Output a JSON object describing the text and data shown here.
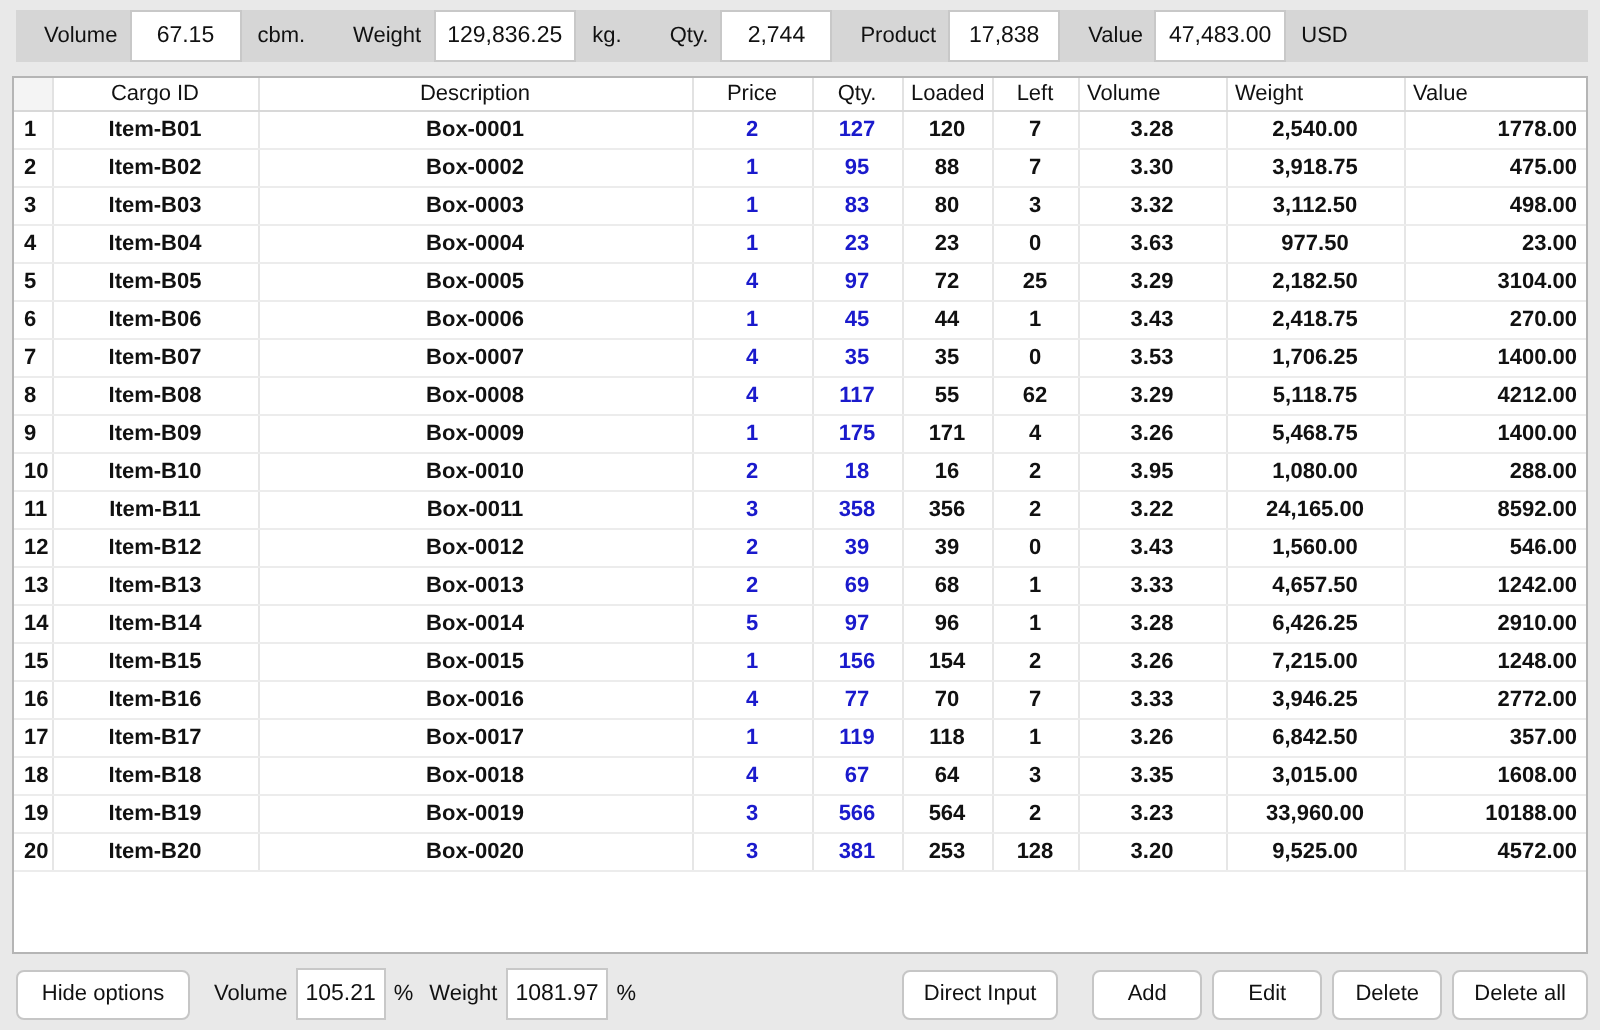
{
  "summary": [
    {
      "label": "Volume",
      "value": "67.15",
      "unit": "cbm."
    },
    {
      "label": "Weight",
      "value": "129,836.25",
      "unit": "kg."
    },
    {
      "label": "Qty.",
      "value": "2,744"
    },
    {
      "label": "Product",
      "value": "17,838"
    },
    {
      "label": "Value",
      "value": "47,483.00",
      "unit": "USD"
    }
  ],
  "table": {
    "columns": [
      {
        "kind": "index"
      },
      {
        "label": "Cargo ID",
        "kind": "plain"
      },
      {
        "label": "Description",
        "kind": "plain"
      },
      {
        "label": "Price",
        "kind": "input"
      },
      {
        "label": "Qty.",
        "kind": "input"
      },
      {
        "label": "Loaded",
        "kind": "plain"
      },
      {
        "label": "Left",
        "kind": "plain"
      },
      {
        "label": "Volume",
        "kind": "plain"
      },
      {
        "label": "Weight",
        "kind": "plain"
      },
      {
        "label": "Value",
        "kind": "plain"
      }
    ],
    "rows": [
      [
        "1",
        "Item-B01",
        "Box-0001",
        "2",
        "127",
        "120",
        "7",
        "3.28",
        "2,540.00",
        "1778.00"
      ],
      [
        "2",
        "Item-B02",
        "Box-0002",
        "1",
        "95",
        "88",
        "7",
        "3.30",
        "3,918.75",
        "475.00"
      ],
      [
        "3",
        "Item-B03",
        "Box-0003",
        "1",
        "83",
        "80",
        "3",
        "3.32",
        "3,112.50",
        "498.00"
      ],
      [
        "4",
        "Item-B04",
        "Box-0004",
        "1",
        "23",
        "23",
        "0",
        "3.63",
        "977.50",
        "23.00"
      ],
      [
        "5",
        "Item-B05",
        "Box-0005",
        "4",
        "97",
        "72",
        "25",
        "3.29",
        "2,182.50",
        "3104.00"
      ],
      [
        "6",
        "Item-B06",
        "Box-0006",
        "1",
        "45",
        "44",
        "1",
        "3.43",
        "2,418.75",
        "270.00"
      ],
      [
        "7",
        "Item-B07",
        "Box-0007",
        "4",
        "35",
        "35",
        "0",
        "3.53",
        "1,706.25",
        "1400.00"
      ],
      [
        "8",
        "Item-B08",
        "Box-0008",
        "4",
        "117",
        "55",
        "62",
        "3.29",
        "5,118.75",
        "4212.00"
      ],
      [
        "9",
        "Item-B09",
        "Box-0009",
        "1",
        "175",
        "171",
        "4",
        "3.26",
        "5,468.75",
        "1400.00"
      ],
      [
        "10",
        "Item-B10",
        "Box-0010",
        "2",
        "18",
        "16",
        "2",
        "3.95",
        "1,080.00",
        "288.00"
      ],
      [
        "11",
        "Item-B11",
        "Box-0011",
        "3",
        "358",
        "356",
        "2",
        "3.22",
        "24,165.00",
        "8592.00"
      ],
      [
        "12",
        "Item-B12",
        "Box-0012",
        "2",
        "39",
        "39",
        "0",
        "3.43",
        "1,560.00",
        "546.00"
      ],
      [
        "13",
        "Item-B13",
        "Box-0013",
        "2",
        "69",
        "68",
        "1",
        "3.33",
        "4,657.50",
        "1242.00"
      ],
      [
        "14",
        "Item-B14",
        "Box-0014",
        "5",
        "97",
        "96",
        "1",
        "3.28",
        "6,426.25",
        "2910.00"
      ],
      [
        "15",
        "Item-B15",
        "Box-0015",
        "1",
        "156",
        "154",
        "2",
        "3.26",
        "7,215.00",
        "1248.00"
      ],
      [
        "16",
        "Item-B16",
        "Box-0016",
        "4",
        "77",
        "70",
        "7",
        "3.33",
        "3,946.25",
        "2772.00"
      ],
      [
        "17",
        "Item-B17",
        "Box-0017",
        "1",
        "119",
        "118",
        "1",
        "3.26",
        "6,842.50",
        "357.00"
      ],
      [
        "18",
        "Item-B18",
        "Box-0018",
        "4",
        "67",
        "64",
        "3",
        "3.35",
        "3,015.00",
        "1608.00"
      ],
      [
        "19",
        "Item-B19",
        "Box-0019",
        "3",
        "566",
        "564",
        "2",
        "3.23",
        "33,960.00",
        "10188.00"
      ],
      [
        "20",
        "Item-B20",
        "Box-0020",
        "3",
        "381",
        "253",
        "128",
        "3.20",
        "9,525.00",
        "4572.00"
      ]
    ]
  },
  "footer": {
    "toggle_button": "Hide options",
    "fields": [
      {
        "label": "Volume",
        "value": "105.21",
        "unit": "%"
      },
      {
        "label": "Weight",
        "value": "1081.97",
        "unit": "%"
      }
    ],
    "buttons": [
      "Direct Input",
      "Add",
      "Edit",
      "Delete",
      "Delete all"
    ]
  }
}
